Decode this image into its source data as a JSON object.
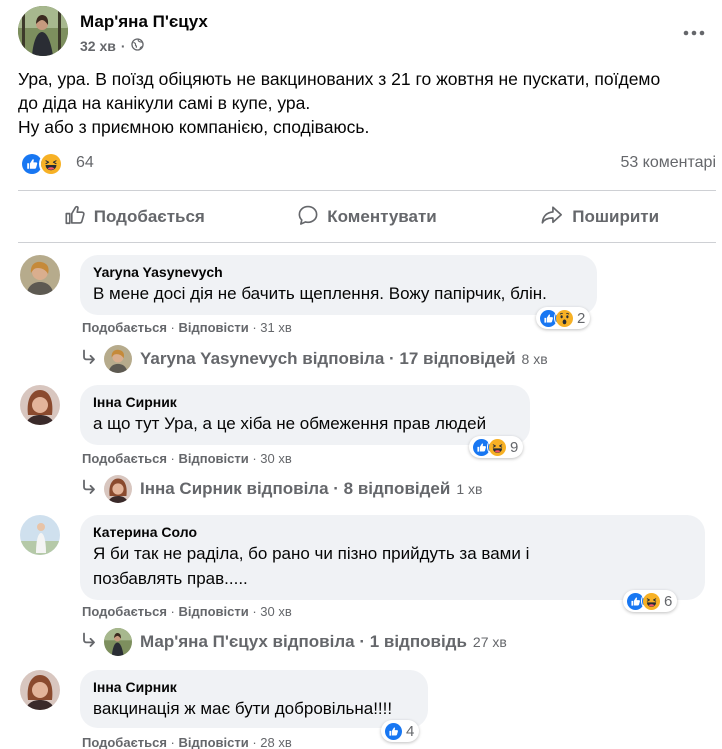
{
  "post": {
    "author": "Мар'яна П'єцух",
    "time": "32 хв",
    "lines": [
      "Ура, ура. В поїзд обіцяють не вакцинованих з 21 го жовтня не пускати, поїдемо",
      "до діда на канікули самі в купе, ура.",
      "Ну або з приємною компанією, сподіваюсь."
    ],
    "reactions_count": "64",
    "comments_count": "53 коментарі"
  },
  "actions": {
    "like": "Подобається",
    "comment": "Коментувати",
    "share": "Поширити"
  },
  "comments": [
    {
      "name": "Yaryna Yasynevych",
      "lines": [
        "В мене досі дія не бачить щеплення. Вожу папірчик, блін."
      ],
      "reactions": "2",
      "like": "Подобається",
      "reply": "Відповісти",
      "time": "31 хв",
      "replies": "Yaryna Yasynevych відповіла · 17 відповідей",
      "replies_time": "8 хв"
    },
    {
      "name": "Інна Сирник",
      "lines": [
        "а що тут Ура, а це хіба не обмеження прав людей"
      ],
      "reactions": "9",
      "like": "Подобається",
      "reply": "Відповісти",
      "time": "30 хв",
      "replies": "Інна Сирник відповіла · 8 відповідей",
      "replies_time": "1 хв"
    },
    {
      "name": "Катерина Соло",
      "lines": [
        "Я би так не раділа, бо рано чи пізно прийдуть за вами і",
        "позбавлять прав....."
      ],
      "reactions": "6",
      "like": "Подобається",
      "reply": "Відповісти",
      "time": "30 хв",
      "replies": "Мар'яна П'єцух відповіла · 1 відповідь",
      "replies_time": "27 хв"
    },
    {
      "name": "Інна Сирник",
      "lines": [
        "вакцинація ж має бути добровільна!!!!"
      ],
      "reactions": "4",
      "like": "Подобається",
      "reply": "Відповісти",
      "time": "28 хв"
    }
  ],
  "icons": {
    "like_reaction": "like-reaction-icon",
    "haha_reaction": "haha-reaction-icon",
    "wow_reaction": "wow-reaction-icon",
    "globe": "globe-icon",
    "more": "more-options-icon",
    "thumb": "thumbs-up-icon",
    "comment": "speech-bubble-icon",
    "share": "share-arrow-icon",
    "reply_arrow": "reply-arrow-icon"
  },
  "colors": {
    "like_blue": "#1877f2",
    "haha_yellow": "#f7b125",
    "secondary_text": "#65676b",
    "bubble_bg": "#f0f2f5"
  }
}
